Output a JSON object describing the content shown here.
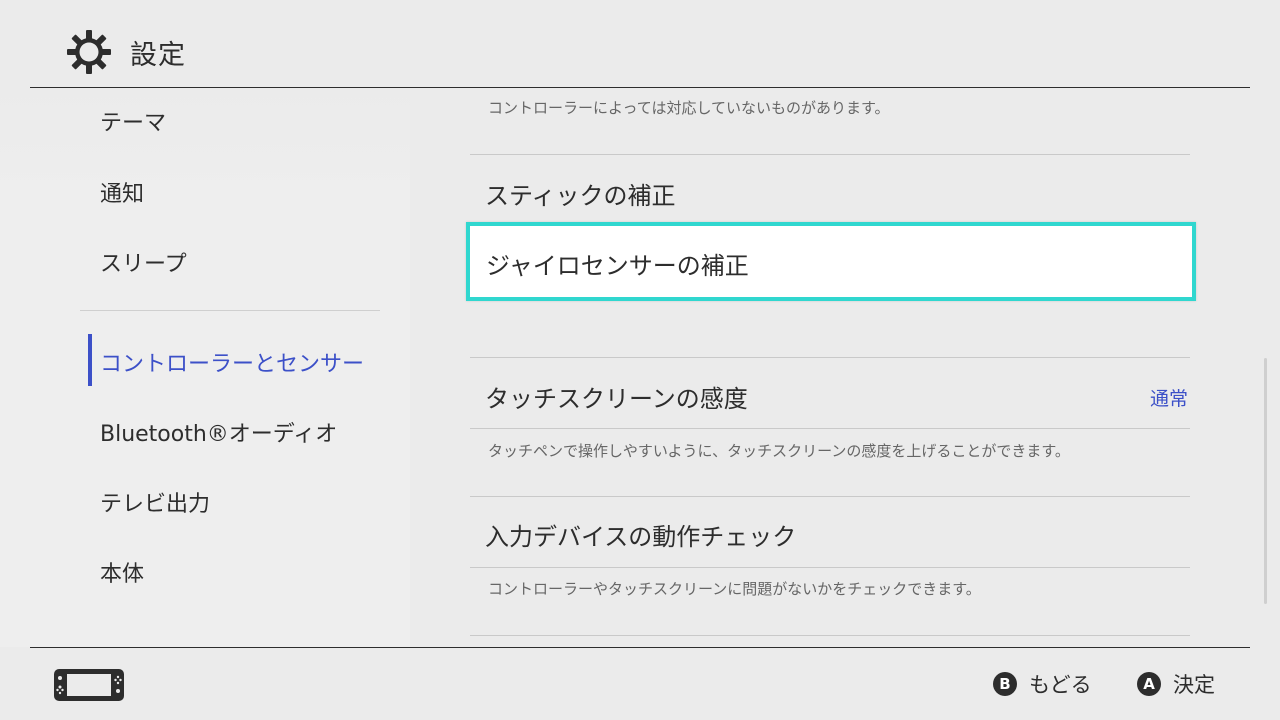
{
  "header": {
    "title": "設定",
    "icon": "gear-icon"
  },
  "sidebar": {
    "items": [
      {
        "label": "テーマ"
      },
      {
        "label": "通知"
      },
      {
        "label": "スリープ"
      },
      {
        "label": "コントローラーとセンサー",
        "active": true
      },
      {
        "label": "Bluetooth®オーディオ"
      },
      {
        "label": "テレビ出力"
      },
      {
        "label": "本体"
      }
    ]
  },
  "main": {
    "top_desc": "コントローラーによっては対応していないものがあります。",
    "rows": [
      {
        "title": "スティックの補正"
      },
      {
        "title": "ジャイロセンサーの補正",
        "selected": true
      },
      {
        "title": "タッチスクリーンの感度",
        "value": "通常",
        "desc": "タッチペンで操作しやすいように、タッチスクリーンの感度を上げることができます。"
      },
      {
        "title": "入力デバイスの動作チェック",
        "desc": "コントローラーやタッチスクリーンに問題がないかをチェックできます。"
      }
    ]
  },
  "footer": {
    "console_icon": "handheld-console-icon",
    "back": {
      "button": "B",
      "label": "もどる"
    },
    "ok": {
      "button": "A",
      "label": "決定"
    }
  },
  "colors": {
    "background": "#ebebeb",
    "accent": "#3c50c8",
    "selection_border": "#30d7cf",
    "text": "#2d2d2d"
  }
}
